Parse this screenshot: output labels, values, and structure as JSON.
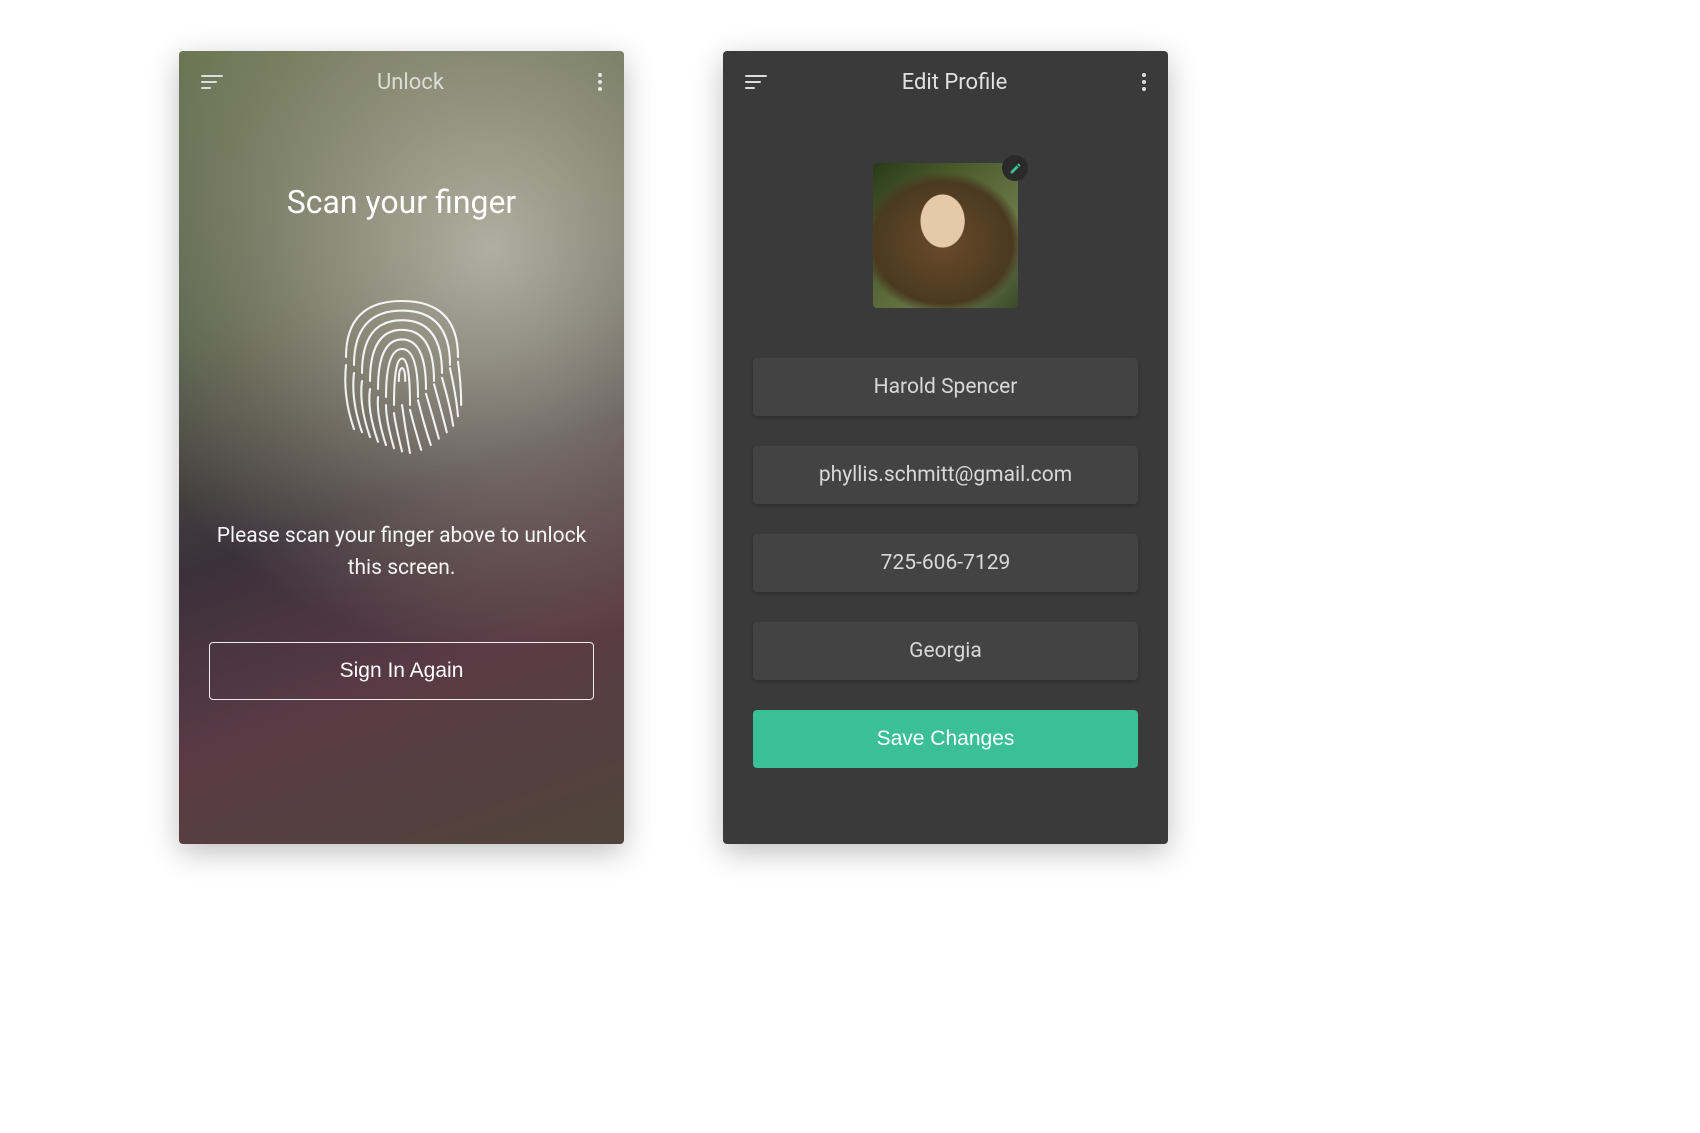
{
  "unlock": {
    "header_title": "Unlock",
    "heading": "Scan your finger",
    "subtext": "Please scan your finger above to unlock this screen.",
    "signin_label": "Sign In Again"
  },
  "edit": {
    "header_title": "Edit Profile",
    "fields": {
      "name": "Harold Spencer",
      "email": "phyllis.schmitt@gmail.com",
      "phone": "725-606-7129",
      "location": "Georgia"
    },
    "save_label": "Save Changes"
  },
  "colors": {
    "accent": "#3bbf95",
    "dark_bg": "#3a3a3a",
    "field_bg": "#434343"
  }
}
